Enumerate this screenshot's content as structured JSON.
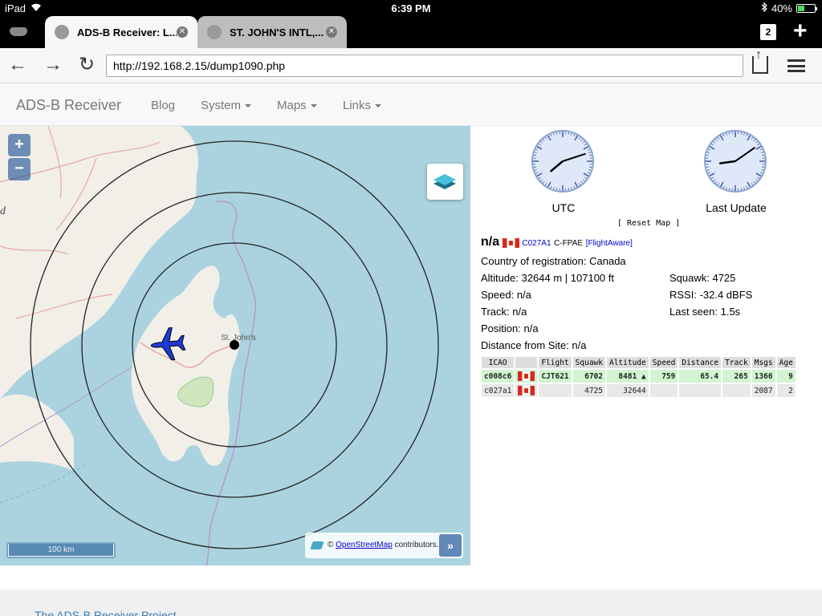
{
  "status": {
    "carrier": "iPad",
    "time": "6:39 PM",
    "battery": "40%",
    "battery_level": 0.4
  },
  "tabs": [
    {
      "title": "ADS-B Receiver: L...",
      "active": true
    },
    {
      "title": "ST. JOHN'S INTL,...",
      "active": false
    }
  ],
  "tab_count": "2",
  "address": {
    "url": "http://192.168.2.15/dump1090.php"
  },
  "site_nav": {
    "brand": "ADS-B Receiver",
    "links": [
      "Blog",
      "System",
      "Maps",
      "Links"
    ]
  },
  "map": {
    "zoom_in": "+",
    "zoom_out": "−",
    "left_edge_letter": "d",
    "city_label": "St. John's",
    "scale_label": "100 km",
    "attribution_prefix": "©",
    "attribution_link": "OpenStreetMap",
    "attribution_suffix": "contributors.",
    "expand": "»"
  },
  "clocks": [
    {
      "label": "UTC",
      "hour_angle": 230,
      "minute_angle": 72
    },
    {
      "label": "Last Update",
      "hour_angle": 262,
      "minute_angle": 55
    }
  ],
  "reset_map": "[ Reset Map ]",
  "selected": {
    "callsign": "n/a",
    "icao": "C027A1",
    "registration": "C-FPAE",
    "flightaware": "[FlightAware]",
    "country": "Country of registration: Canada",
    "altitude": "Altitude: 32644 m | 107100 ft",
    "squawk": "Squawk: 4725",
    "speed": "Speed: n/a",
    "rssi": "RSSI: -32.4 dBFS",
    "track": "Track: n/a",
    "last_seen": "Last seen: 1.5s",
    "position": "Position: n/a",
    "distance": "Distance from Site: n/a"
  },
  "table": {
    "headers": [
      "ICAO",
      "",
      "Flight",
      "Squawk",
      "Altitude",
      "Speed",
      "Distance",
      "Track",
      "Msgs",
      "Age"
    ],
    "rows": [
      [
        "c008c6",
        "",
        "CJT621",
        "6702",
        "8481 ▲",
        "759",
        "65.4",
        "265",
        "1366",
        "9"
      ],
      [
        "c027a1",
        "",
        "",
        "4725",
        "32644",
        "",
        "",
        "",
        "2087",
        "2"
      ]
    ]
  },
  "footer": {
    "text": "The ADS-B Receiver Project"
  },
  "colors": {
    "water": "#aad3df",
    "land": "#f2efe9",
    "nav_text": "#777777",
    "selected_row": "#d0f5d0"
  }
}
